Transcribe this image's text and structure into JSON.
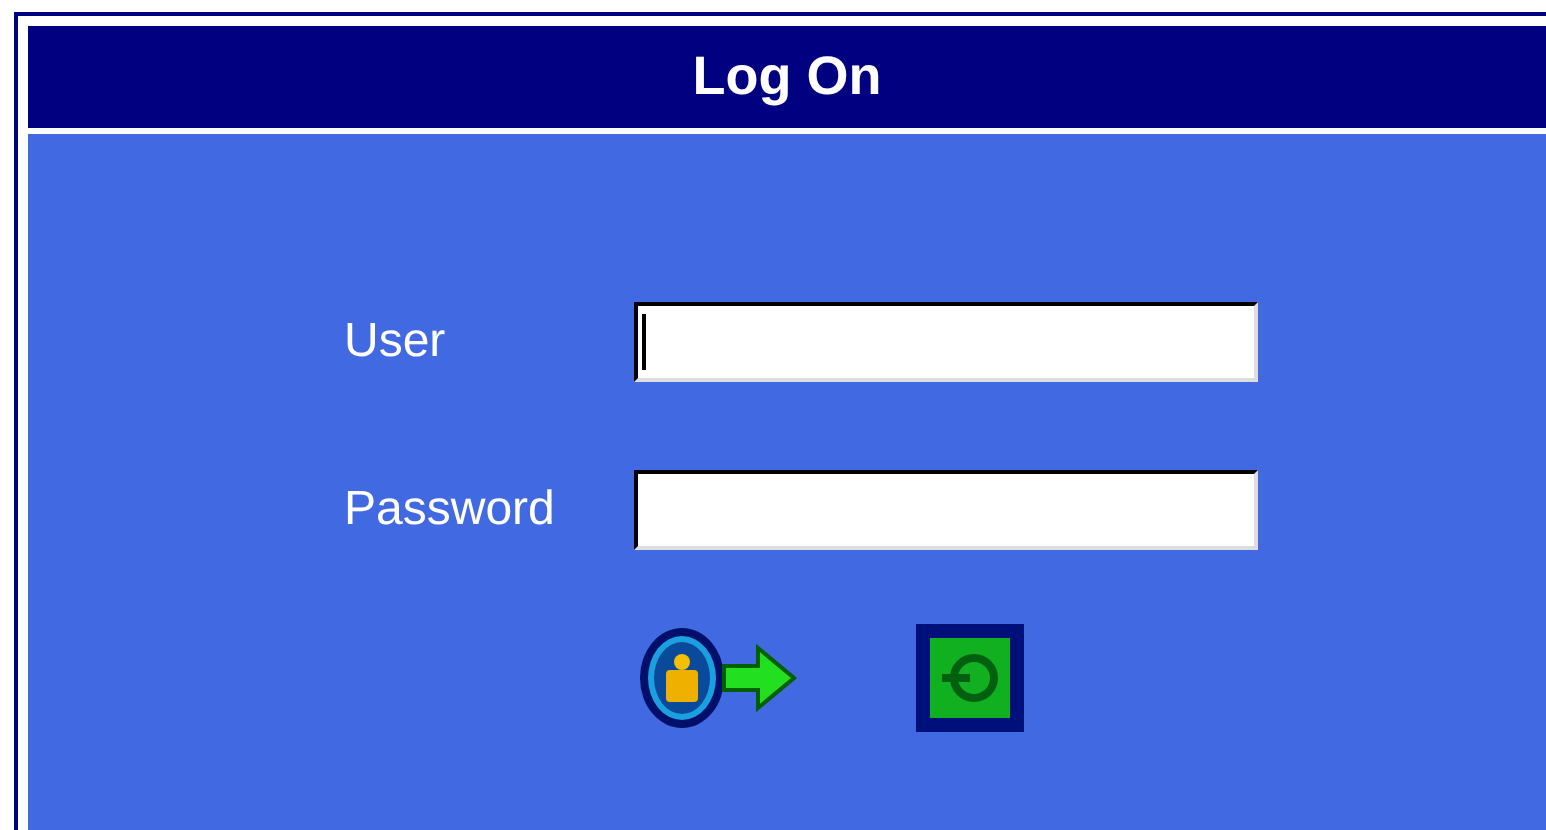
{
  "window": {
    "title": "Log On"
  },
  "fields": [
    {
      "label": "User",
      "focused": true
    },
    {
      "label": "Password"
    }
  ],
  "buttons": [
    {
      "kind": "login"
    },
    {
      "kind": "exit"
    }
  ]
}
